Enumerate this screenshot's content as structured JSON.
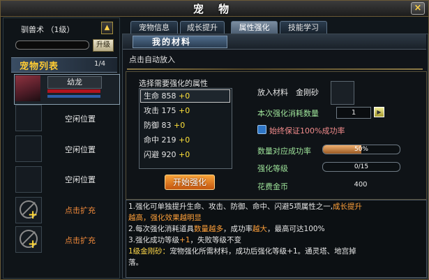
{
  "window": {
    "title": "宠 物",
    "close_label": "×"
  },
  "left": {
    "skill_label": "驯兽术 （1级）",
    "skill_up_icon": "▲",
    "upgrade_button": "升级",
    "list_title": "宠物列表",
    "list_count": "1/4",
    "pet": {
      "name": "幼龙"
    },
    "slots": [
      "空闲位置",
      "空闲位置",
      "空闲位置"
    ],
    "expand": [
      "点击扩充",
      "点击扩充"
    ]
  },
  "tabs": [
    "宠物信息",
    "成长提升",
    "属性强化",
    "技能学习"
  ],
  "active_tab_index": 2,
  "material": {
    "title": "我的材料",
    "auto_hint": "点击自动放入"
  },
  "enhance": {
    "select_label": "选择需要强化的属性",
    "attributes": [
      {
        "name": "生命",
        "value": "858",
        "plus": "+0"
      },
      {
        "name": "攻击",
        "value": "175",
        "plus": "+0"
      },
      {
        "name": "防御",
        "value": "83",
        "plus": "+0"
      },
      {
        "name": "命中",
        "value": "219",
        "plus": "+0"
      },
      {
        "name": "闪避",
        "value": "920",
        "plus": "+0"
      }
    ],
    "selected_index": 0,
    "start_button": "开始强化",
    "put_material_label": "放入材料",
    "material_name": "金刚砂",
    "consume_label": "本次强化消耗数量",
    "consume_value": "1",
    "guarantee_label": "始终保证100%成功率",
    "rate_label": "数量对应成功率",
    "rate_value": "50%",
    "rate_fraction": 0.5,
    "level_label": "强化等级",
    "level_value": "0/15",
    "level_fraction": 0,
    "cost_label": "花费金币",
    "cost_value": "400"
  },
  "description": {
    "line1_pre": "1.强化可单独提升生命、攻击、防御、命中、闪避5项属性之一,",
    "line1_hl": "成长提升",
    "line2_hl": "越高，强化效果越明显",
    "line3_pre": "2.每次强化消耗道具",
    "line3_hl1": "数量越多",
    "line3_mid": "，成功率",
    "line3_hl2": "越大",
    "line3_post": "，最高可达100%",
    "line4_pre": "3.强化成功等级",
    "line4_hl": "+1",
    "line4_post": "，失败等级不变",
    "line5_gold": "1级金刚砂：",
    "line5_post": "宠物强化所需材料，成功后强化等级+1。通灵塔、地宫掉",
    "line6": "落。"
  },
  "colors": {
    "accent_gold": "#ffcc33",
    "highlight_orange": "#ffa03a",
    "button_orange": "#e07a20"
  }
}
